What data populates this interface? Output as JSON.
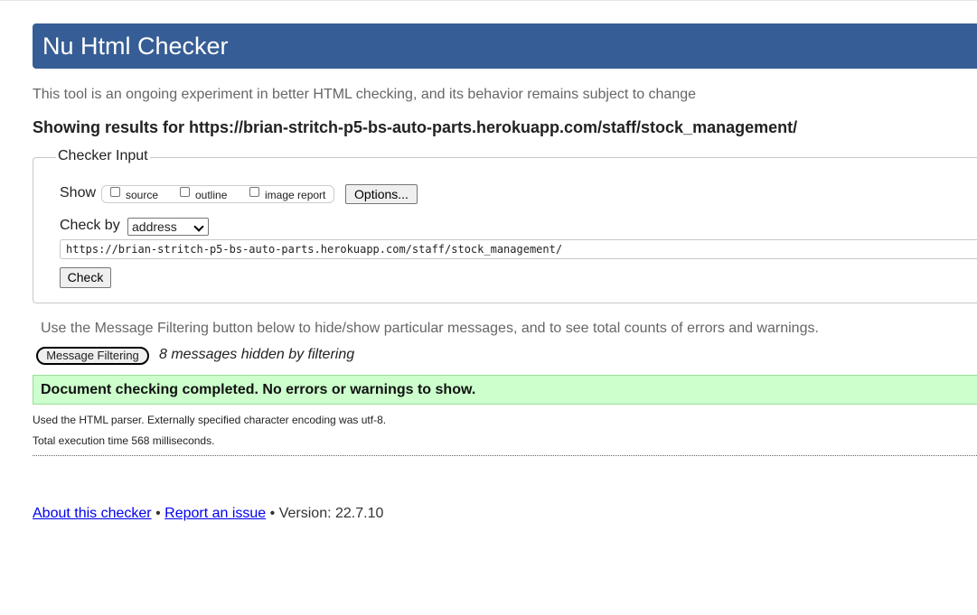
{
  "header": {
    "title": "Nu Html Checker"
  },
  "subtitle": "This tool is an ongoing experiment in better HTML checking, and its behavior remains subject to change",
  "results_heading": "Showing results for https://brian-stritch-p5-bs-auto-parts.herokuapp.com/staff/stock_management/",
  "checker_input": {
    "legend": "Checker Input",
    "show_label": "Show",
    "show_options": [
      {
        "label": "source",
        "checked": false
      },
      {
        "label": "outline",
        "checked": false
      },
      {
        "label": "image report",
        "checked": false
      }
    ],
    "options_button": "Options...",
    "check_by_label": "Check by",
    "check_by_value": "address",
    "url_value": "https://brian-stritch-p5-bs-auto-parts.herokuapp.com/staff/stock_management/",
    "check_button": "Check"
  },
  "filtering": {
    "note": "Use the Message Filtering button below to hide/show particular messages, and to see total counts of errors and warnings.",
    "button": "Message Filtering",
    "hidden_count_text": "8 messages hidden by filtering"
  },
  "result_message": "Document checking completed. No errors or warnings to show.",
  "parser_info": "Used the HTML parser. Externally specified character encoding was utf-8.",
  "execution_time": "Total execution time 568 milliseconds.",
  "footer": {
    "about_link": "About this checker",
    "separator": "•",
    "report_link": "Report an issue",
    "version": "Version: 22.7.10"
  },
  "colors": {
    "header_bg": "#365d95",
    "success_bg": "#ccffcc",
    "link": "#0000ee"
  }
}
